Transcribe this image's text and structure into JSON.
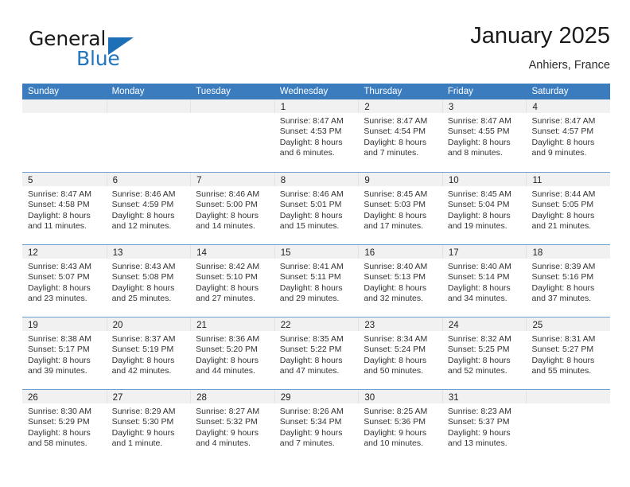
{
  "brand": {
    "name_part1": "General",
    "name_part2": "Blue",
    "logo_icon": "triangle-logo-icon"
  },
  "header": {
    "title": "January 2025",
    "subtitle": "Anhiers, France"
  },
  "calendar": {
    "weekday_headers": [
      "Sunday",
      "Monday",
      "Tuesday",
      "Wednesday",
      "Thursday",
      "Friday",
      "Saturday"
    ],
    "accent_color": "#3a7cbe",
    "band_color": "#f1f1f1",
    "weeks": [
      [
        {
          "empty": true
        },
        {
          "empty": true
        },
        {
          "empty": true
        },
        {
          "day": "1",
          "sunrise": "Sunrise: 8:47 AM",
          "sunset": "Sunset: 4:53 PM",
          "daylight_line1": "Daylight: 8 hours",
          "daylight_line2": "and 6 minutes."
        },
        {
          "day": "2",
          "sunrise": "Sunrise: 8:47 AM",
          "sunset": "Sunset: 4:54 PM",
          "daylight_line1": "Daylight: 8 hours",
          "daylight_line2": "and 7 minutes."
        },
        {
          "day": "3",
          "sunrise": "Sunrise: 8:47 AM",
          "sunset": "Sunset: 4:55 PM",
          "daylight_line1": "Daylight: 8 hours",
          "daylight_line2": "and 8 minutes."
        },
        {
          "day": "4",
          "sunrise": "Sunrise: 8:47 AM",
          "sunset": "Sunset: 4:57 PM",
          "daylight_line1": "Daylight: 8 hours",
          "daylight_line2": "and 9 minutes."
        }
      ],
      [
        {
          "day": "5",
          "sunrise": "Sunrise: 8:47 AM",
          "sunset": "Sunset: 4:58 PM",
          "daylight_line1": "Daylight: 8 hours",
          "daylight_line2": "and 11 minutes."
        },
        {
          "day": "6",
          "sunrise": "Sunrise: 8:46 AM",
          "sunset": "Sunset: 4:59 PM",
          "daylight_line1": "Daylight: 8 hours",
          "daylight_line2": "and 12 minutes."
        },
        {
          "day": "7",
          "sunrise": "Sunrise: 8:46 AM",
          "sunset": "Sunset: 5:00 PM",
          "daylight_line1": "Daylight: 8 hours",
          "daylight_line2": "and 14 minutes."
        },
        {
          "day": "8",
          "sunrise": "Sunrise: 8:46 AM",
          "sunset": "Sunset: 5:01 PM",
          "daylight_line1": "Daylight: 8 hours",
          "daylight_line2": "and 15 minutes."
        },
        {
          "day": "9",
          "sunrise": "Sunrise: 8:45 AM",
          "sunset": "Sunset: 5:03 PM",
          "daylight_line1": "Daylight: 8 hours",
          "daylight_line2": "and 17 minutes."
        },
        {
          "day": "10",
          "sunrise": "Sunrise: 8:45 AM",
          "sunset": "Sunset: 5:04 PM",
          "daylight_line1": "Daylight: 8 hours",
          "daylight_line2": "and 19 minutes."
        },
        {
          "day": "11",
          "sunrise": "Sunrise: 8:44 AM",
          "sunset": "Sunset: 5:05 PM",
          "daylight_line1": "Daylight: 8 hours",
          "daylight_line2": "and 21 minutes."
        }
      ],
      [
        {
          "day": "12",
          "sunrise": "Sunrise: 8:43 AM",
          "sunset": "Sunset: 5:07 PM",
          "daylight_line1": "Daylight: 8 hours",
          "daylight_line2": "and 23 minutes."
        },
        {
          "day": "13",
          "sunrise": "Sunrise: 8:43 AM",
          "sunset": "Sunset: 5:08 PM",
          "daylight_line1": "Daylight: 8 hours",
          "daylight_line2": "and 25 minutes."
        },
        {
          "day": "14",
          "sunrise": "Sunrise: 8:42 AM",
          "sunset": "Sunset: 5:10 PM",
          "daylight_line1": "Daylight: 8 hours",
          "daylight_line2": "and 27 minutes."
        },
        {
          "day": "15",
          "sunrise": "Sunrise: 8:41 AM",
          "sunset": "Sunset: 5:11 PM",
          "daylight_line1": "Daylight: 8 hours",
          "daylight_line2": "and 29 minutes."
        },
        {
          "day": "16",
          "sunrise": "Sunrise: 8:40 AM",
          "sunset": "Sunset: 5:13 PM",
          "daylight_line1": "Daylight: 8 hours",
          "daylight_line2": "and 32 minutes."
        },
        {
          "day": "17",
          "sunrise": "Sunrise: 8:40 AM",
          "sunset": "Sunset: 5:14 PM",
          "daylight_line1": "Daylight: 8 hours",
          "daylight_line2": "and 34 minutes."
        },
        {
          "day": "18",
          "sunrise": "Sunrise: 8:39 AM",
          "sunset": "Sunset: 5:16 PM",
          "daylight_line1": "Daylight: 8 hours",
          "daylight_line2": "and 37 minutes."
        }
      ],
      [
        {
          "day": "19",
          "sunrise": "Sunrise: 8:38 AM",
          "sunset": "Sunset: 5:17 PM",
          "daylight_line1": "Daylight: 8 hours",
          "daylight_line2": "and 39 minutes."
        },
        {
          "day": "20",
          "sunrise": "Sunrise: 8:37 AM",
          "sunset": "Sunset: 5:19 PM",
          "daylight_line1": "Daylight: 8 hours",
          "daylight_line2": "and 42 minutes."
        },
        {
          "day": "21",
          "sunrise": "Sunrise: 8:36 AM",
          "sunset": "Sunset: 5:20 PM",
          "daylight_line1": "Daylight: 8 hours",
          "daylight_line2": "and 44 minutes."
        },
        {
          "day": "22",
          "sunrise": "Sunrise: 8:35 AM",
          "sunset": "Sunset: 5:22 PM",
          "daylight_line1": "Daylight: 8 hours",
          "daylight_line2": "and 47 minutes."
        },
        {
          "day": "23",
          "sunrise": "Sunrise: 8:34 AM",
          "sunset": "Sunset: 5:24 PM",
          "daylight_line1": "Daylight: 8 hours",
          "daylight_line2": "and 50 minutes."
        },
        {
          "day": "24",
          "sunrise": "Sunrise: 8:32 AM",
          "sunset": "Sunset: 5:25 PM",
          "daylight_line1": "Daylight: 8 hours",
          "daylight_line2": "and 52 minutes."
        },
        {
          "day": "25",
          "sunrise": "Sunrise: 8:31 AM",
          "sunset": "Sunset: 5:27 PM",
          "daylight_line1": "Daylight: 8 hours",
          "daylight_line2": "and 55 minutes."
        }
      ],
      [
        {
          "day": "26",
          "sunrise": "Sunrise: 8:30 AM",
          "sunset": "Sunset: 5:29 PM",
          "daylight_line1": "Daylight: 8 hours",
          "daylight_line2": "and 58 minutes."
        },
        {
          "day": "27",
          "sunrise": "Sunrise: 8:29 AM",
          "sunset": "Sunset: 5:30 PM",
          "daylight_line1": "Daylight: 9 hours",
          "daylight_line2": "and 1 minute."
        },
        {
          "day": "28",
          "sunrise": "Sunrise: 8:27 AM",
          "sunset": "Sunset: 5:32 PM",
          "daylight_line1": "Daylight: 9 hours",
          "daylight_line2": "and 4 minutes."
        },
        {
          "day": "29",
          "sunrise": "Sunrise: 8:26 AM",
          "sunset": "Sunset: 5:34 PM",
          "daylight_line1": "Daylight: 9 hours",
          "daylight_line2": "and 7 minutes."
        },
        {
          "day": "30",
          "sunrise": "Sunrise: 8:25 AM",
          "sunset": "Sunset: 5:36 PM",
          "daylight_line1": "Daylight: 9 hours",
          "daylight_line2": "and 10 minutes."
        },
        {
          "day": "31",
          "sunrise": "Sunrise: 8:23 AM",
          "sunset": "Sunset: 5:37 PM",
          "daylight_line1": "Daylight: 9 hours",
          "daylight_line2": "and 13 minutes."
        },
        {
          "empty": true
        }
      ]
    ]
  }
}
